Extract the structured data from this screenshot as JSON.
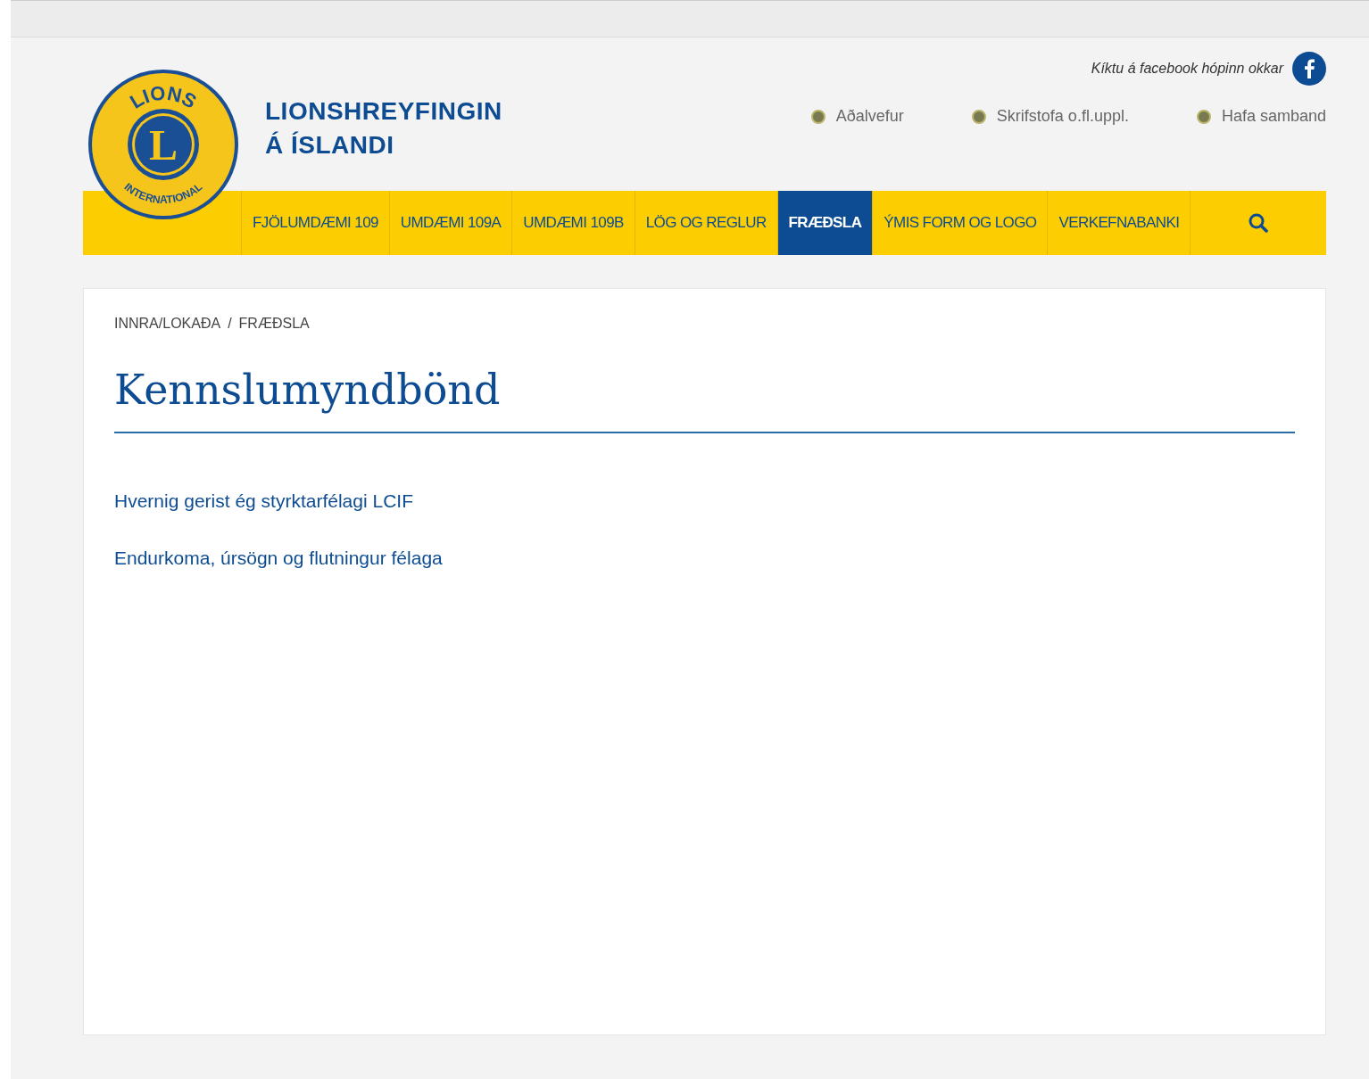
{
  "logo": {
    "top_text": "LIONS",
    "center_text": "L",
    "bottom_text": "INTERNATIONAL"
  },
  "site_title": [
    "LIONSHREYFINGIN",
    "Á ÍSLANDI"
  ],
  "facebook": {
    "label": "Kíktu á facebook hópinn okkar"
  },
  "top_links": [
    "Aðalvefur",
    "Skrifstofa o.fl.uppl.",
    "Hafa samband"
  ],
  "nav": [
    {
      "label": "FJÖLUMDÆMI 109",
      "selected": false
    },
    {
      "label": "UMDÆMI 109A",
      "selected": false
    },
    {
      "label": "UMDÆMI 109B",
      "selected": false
    },
    {
      "label": "LÖG OG REGLUR",
      "selected": false
    },
    {
      "label": "FRÆÐSLA",
      "selected": true
    },
    {
      "label": "ÝMIS FORM OG LOGO",
      "selected": false
    },
    {
      "label": "VERKEFNABANKI",
      "selected": false
    }
  ],
  "breadcrumb": [
    "INNRA/LOKAÐA",
    "FRÆÐSLA"
  ],
  "breadcrumb_separator": "/",
  "heading": "Kennslumyndbönd",
  "links": [
    "Hvernig gerist ég styrktarfélagi LCIF",
    "Endurkoma, úrsögn og flutningur félaga"
  ]
}
